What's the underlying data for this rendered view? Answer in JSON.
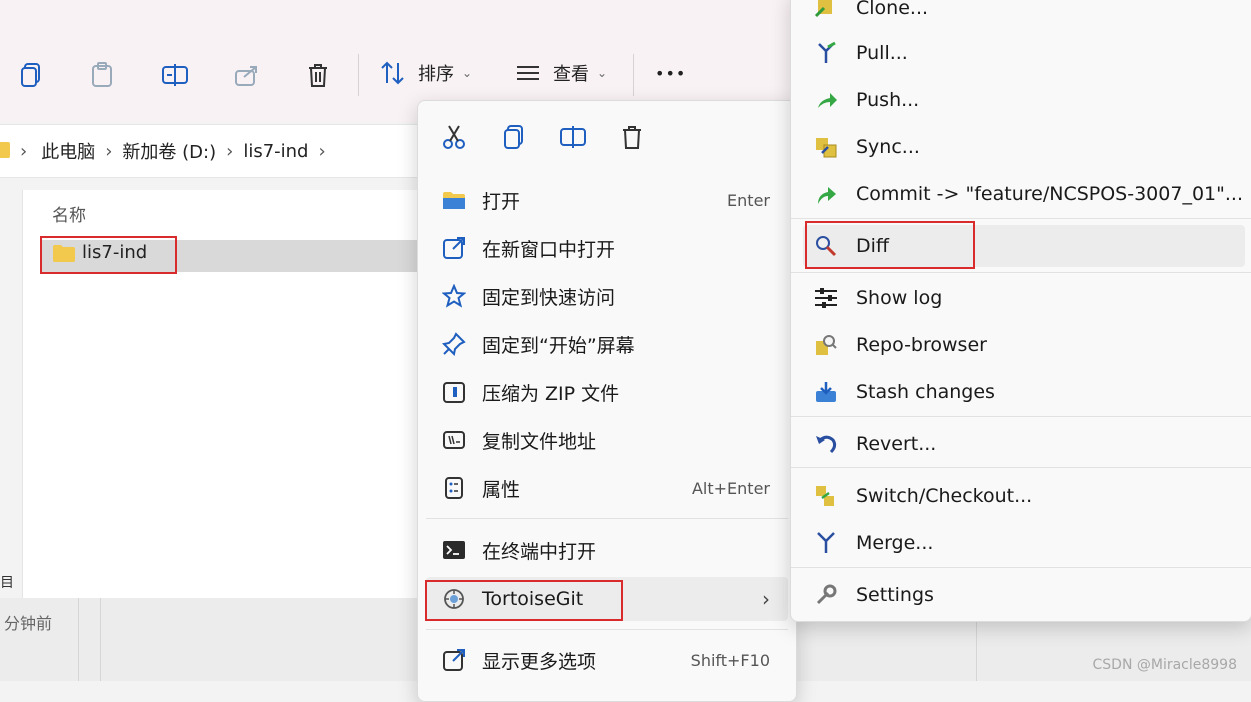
{
  "toolbar": {
    "sort_label": "排序",
    "view_label": "查看",
    "more_label": "•••"
  },
  "address": {
    "crumbs": [
      "此电脑",
      "新加卷 (D:)",
      "lis7-ind"
    ],
    "separator": "›"
  },
  "file_list": {
    "column_name": "名称",
    "items": [
      {
        "name": "lis7-ind",
        "selected": true
      }
    ],
    "sidebar_fragment": "目",
    "time_fragment": "分钟前"
  },
  "context_menu": {
    "items": [
      {
        "label": "打开",
        "shortcut": "Enter",
        "icon": "folder-icon"
      },
      {
        "label": "在新窗口中打开",
        "shortcut": "",
        "icon": "open-new-window-icon"
      },
      {
        "label": "固定到快速访问",
        "shortcut": "",
        "icon": "star-icon"
      },
      {
        "label": "固定到“开始”屏幕",
        "shortcut": "",
        "icon": "pin-icon"
      },
      {
        "label": "压缩为 ZIP 文件",
        "shortcut": "",
        "icon": "zip-icon"
      },
      {
        "label": "复制文件地址",
        "shortcut": "",
        "icon": "copy-path-icon"
      },
      {
        "label": "属性",
        "shortcut": "Alt+Enter",
        "icon": "properties-icon"
      },
      {
        "label": "在终端中打开",
        "shortcut": "",
        "icon": "terminal-icon"
      },
      {
        "label": "TortoiseGit",
        "shortcut": "",
        "icon": "tortoisegit-icon",
        "highlighted": true
      },
      {
        "label": "显示更多选项",
        "shortcut": "Shift+F10",
        "icon": "show-more-icon"
      }
    ]
  },
  "submenu": {
    "items": [
      {
        "label": "Clone...",
        "icon": "clone-icon"
      },
      {
        "label": "Pull...",
        "icon": "pull-icon"
      },
      {
        "label": "Push...",
        "icon": "push-icon"
      },
      {
        "label": "Sync...",
        "icon": "sync-icon"
      },
      {
        "label": "Commit -> \"feature/NCSPOS-3007_01\"...",
        "icon": "commit-icon"
      },
      {
        "label": "Diff",
        "icon": "diff-icon",
        "highlighted": true
      },
      {
        "label": "Show log",
        "icon": "log-icon"
      },
      {
        "label": "Repo-browser",
        "icon": "repo-browser-icon"
      },
      {
        "label": "Stash changes",
        "icon": "stash-icon"
      },
      {
        "label": "Revert...",
        "icon": "revert-icon"
      },
      {
        "label": "Switch/Checkout...",
        "icon": "switch-icon"
      },
      {
        "label": "Merge...",
        "icon": "merge-icon"
      },
      {
        "label": "Settings",
        "icon": "settings-icon"
      }
    ]
  },
  "watermark": "CSDN @Miracle8998",
  "colors": {
    "highlight_box": "#d92b2b",
    "accent_blue": "#1f5fbf",
    "folder_yellow": "#f2c94c"
  }
}
